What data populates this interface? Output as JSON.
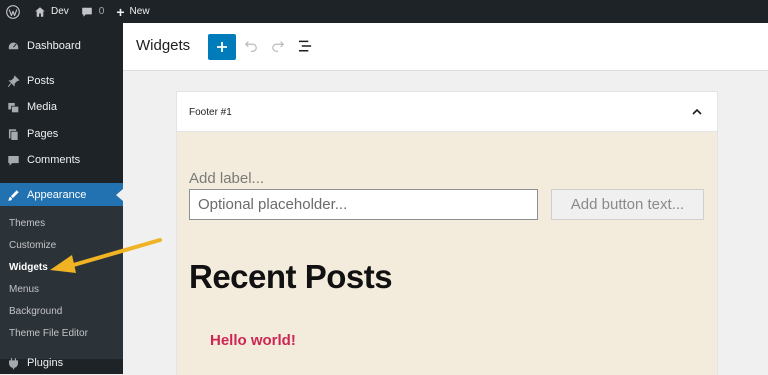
{
  "adminbar": {
    "site_name": "Dev",
    "comments_count": "0",
    "new_label": "New"
  },
  "sidebar": {
    "items": [
      {
        "label": "Dashboard",
        "icon": "dashboard-icon"
      },
      {
        "label": "Posts",
        "icon": "pin-icon"
      },
      {
        "label": "Media",
        "icon": "media-icon"
      },
      {
        "label": "Pages",
        "icon": "pages-icon"
      },
      {
        "label": "Comments",
        "icon": "comments-icon"
      },
      {
        "label": "Appearance",
        "icon": "appearance-icon"
      },
      {
        "label": "Plugins",
        "icon": "plugins-icon"
      }
    ],
    "submenu": [
      "Themes",
      "Customize",
      "Widgets",
      "Menus",
      "Background",
      "Theme File Editor"
    ]
  },
  "header": {
    "title": "Widgets"
  },
  "widget_area": {
    "title": "Footer #1",
    "field_label": "Add label...",
    "input_placeholder": "Optional placeholder...",
    "button_text": "Add button text...",
    "heading": "Recent Posts",
    "posts": [
      "Hello world!"
    ]
  },
  "colors": {
    "admin_dark": "#1d2327",
    "accent": "#2271b1",
    "primary_button": "#007cba",
    "widget_bg": "#f3ecdd",
    "post_link": "#cd2653",
    "annotation_arrow": "#f0b323"
  }
}
